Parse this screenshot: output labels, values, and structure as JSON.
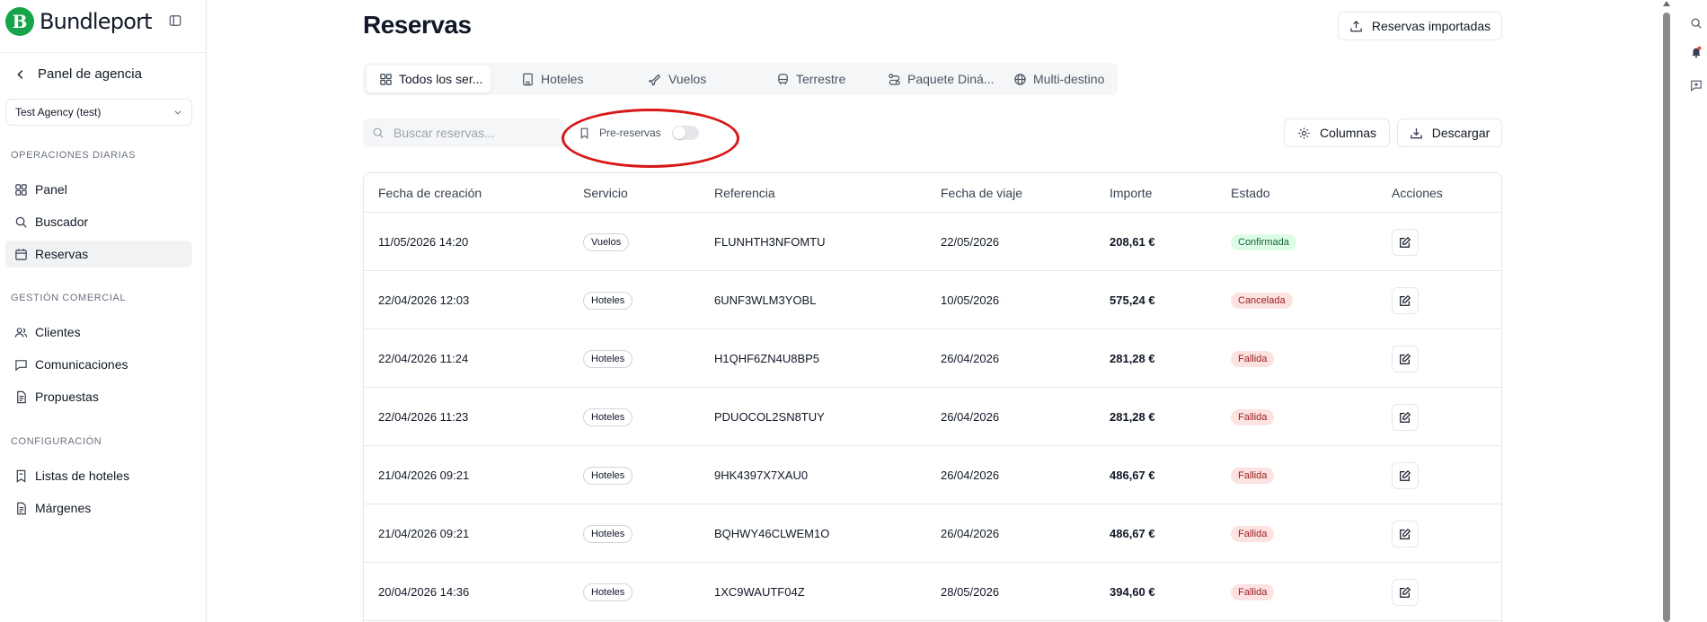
{
  "brand": {
    "name": "Bundleport",
    "logo_letter": "B",
    "color": "#16a34a"
  },
  "sidebar": {
    "back_label": "Panel de agencia",
    "agency_select": "Test Agency (test)",
    "sections": [
      {
        "label": "OPERACIONES DIARIAS",
        "items": [
          {
            "label": "Panel",
            "icon": "grid-icon"
          },
          {
            "label": "Buscador",
            "icon": "search-icon"
          },
          {
            "label": "Reservas",
            "icon": "calendar-icon",
            "active": true
          }
        ]
      },
      {
        "label": "GESTIÓN COMERCIAL",
        "items": [
          {
            "label": "Clientes",
            "icon": "users-icon"
          },
          {
            "label": "Comunicaciones",
            "icon": "message-icon"
          },
          {
            "label": "Propuestas",
            "icon": "document-icon"
          }
        ]
      },
      {
        "label": "CONFIGURACIÓN",
        "items": [
          {
            "label": "Listas de hoteles",
            "icon": "bookmark-list-icon"
          },
          {
            "label": "Márgenes",
            "icon": "document-icon"
          }
        ]
      }
    ]
  },
  "header": {
    "title": "Reservas",
    "imported_button": "Reservas importadas"
  },
  "tabs": [
    {
      "label": "Todos los ser...",
      "icon": "grid-icon",
      "active": true
    },
    {
      "label": "Hoteles",
      "icon": "building-icon"
    },
    {
      "label": "Vuelos",
      "icon": "plane-icon"
    },
    {
      "label": "Terrestre",
      "icon": "bus-icon"
    },
    {
      "label": "Paquete Diná...",
      "icon": "route-icon"
    },
    {
      "label": "Multi-destino",
      "icon": "globe-icon"
    }
  ],
  "toolbar": {
    "search_placeholder": "Buscar reservas...",
    "prebookings_label": "Pre-reservas",
    "prebookings_on": false,
    "columns_button": "Columnas",
    "download_button": "Descargar"
  },
  "table": {
    "columns": [
      "Fecha de creación",
      "Servicio",
      "Referencia",
      "Fecha de viaje",
      "Importe",
      "Estado",
      "Acciones"
    ],
    "rows": [
      {
        "created": "11/05/2026 14:20",
        "service": "Vuelos",
        "reference": "FLUNHTH3NFOMTU",
        "travel_date": "22/05/2026",
        "amount": "208,61 €",
        "status": "Confirmada",
        "status_kind": "ok"
      },
      {
        "created": "22/04/2026 12:03",
        "service": "Hoteles",
        "reference": "6UNF3WLM3YOBL",
        "travel_date": "10/05/2026",
        "amount": "575,24 €",
        "status": "Cancelada",
        "status_kind": "cancel"
      },
      {
        "created": "22/04/2026 11:24",
        "service": "Hoteles",
        "reference": "H1QHF6ZN4U8BP5",
        "travel_date": "26/04/2026",
        "amount": "281,28 €",
        "status": "Fallida",
        "status_kind": "fail"
      },
      {
        "created": "22/04/2026 11:23",
        "service": "Hoteles",
        "reference": "PDUOCOL2SN8TUY",
        "travel_date": "26/04/2026",
        "amount": "281,28 €",
        "status": "Fallida",
        "status_kind": "fail"
      },
      {
        "created": "21/04/2026 09:21",
        "service": "Hoteles",
        "reference": "9HK4397X7XAU0",
        "travel_date": "26/04/2026",
        "amount": "486,67 €",
        "status": "Fallida",
        "status_kind": "fail"
      },
      {
        "created": "21/04/2026 09:21",
        "service": "Hoteles",
        "reference": "BQHWY46CLWEM1O",
        "travel_date": "26/04/2026",
        "amount": "486,67 €",
        "status": "Fallida",
        "status_kind": "fail"
      },
      {
        "created": "20/04/2026 14:36",
        "service": "Hoteles",
        "reference": "1XC9WAUTF04Z",
        "travel_date": "28/05/2026",
        "amount": "394,60 €",
        "status": "Fallida",
        "status_kind": "fail"
      }
    ]
  },
  "colors": {
    "highlight": "#d81818",
    "confirmed_bg": "#dcfce7",
    "failed_bg": "#fde2e2"
  }
}
